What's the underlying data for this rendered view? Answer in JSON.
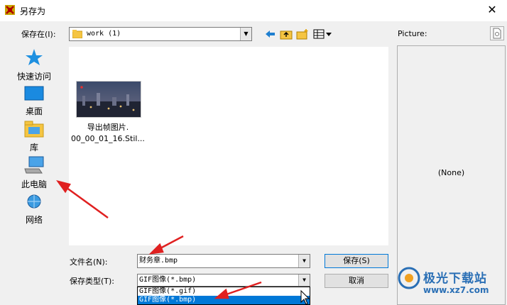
{
  "window": {
    "title": "另存为"
  },
  "toolbar": {
    "save_in_label": "保存在(I):",
    "save_in_value": "work (1)"
  },
  "places": [
    {
      "label": "快速访问",
      "icon": "star-icon"
    },
    {
      "label": "桌面",
      "icon": "desktop-icon"
    },
    {
      "label": "库",
      "icon": "library-folder-icon"
    },
    {
      "label": "此电脑",
      "icon": "computer-icon"
    },
    {
      "label": "网络",
      "icon": "network-icon"
    }
  ],
  "files": [
    {
      "name_line1": "导出帧图片.",
      "name_line2": "00_00_01_16.Stil..."
    }
  ],
  "filename": {
    "label": "文件名(N):",
    "value": "财务章.bmp"
  },
  "filetype": {
    "label": "保存类型(T):",
    "value": "GIF图像(*.bmp)",
    "options": [
      "GIF图像(*.gif)",
      "GIF图像(*.bmp)"
    ],
    "selected_index": 1
  },
  "buttons": {
    "save": "保存(S)",
    "cancel": "取消"
  },
  "preview": {
    "label": "Picture:",
    "empty_text": "(None)"
  },
  "watermark": {
    "text": "极光下载站",
    "url": "www.xz7.com"
  },
  "colors": {
    "accent": "#0078d7",
    "annotation_red": "#e02020"
  }
}
